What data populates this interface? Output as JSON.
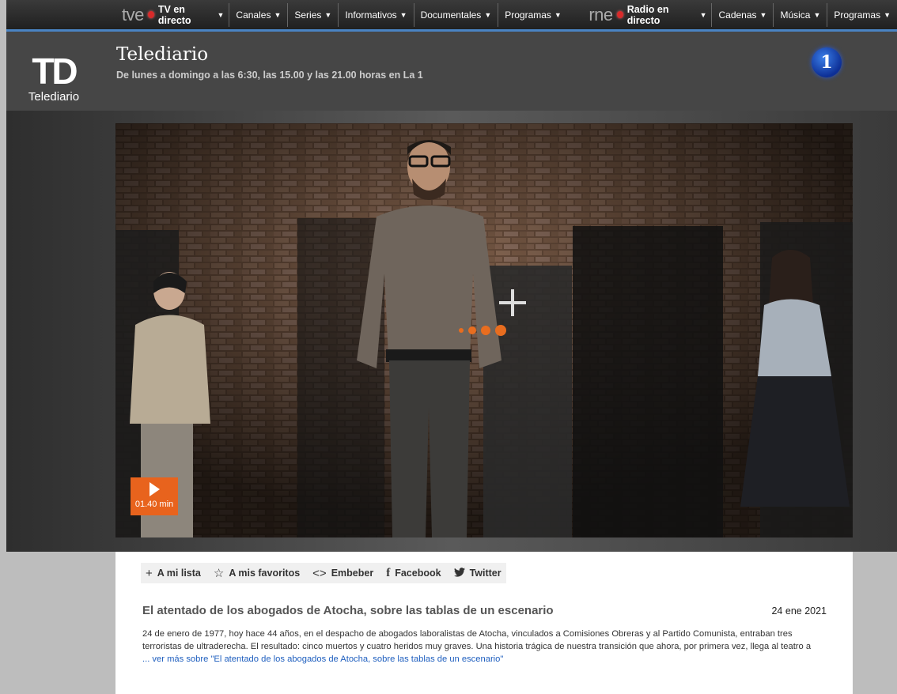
{
  "nav": {
    "tve_logo": "tve",
    "tv_live": "TV en directo",
    "tv_items": [
      "Canales",
      "Series",
      "Informativos",
      "Documentales",
      "Programas"
    ],
    "rne_logo": "rne",
    "radio_live": "Radio en directo",
    "radio_items": [
      "Cadenas",
      "Música",
      "Programas"
    ]
  },
  "header": {
    "logo_mark": "TD",
    "logo_text": "Telediario",
    "title": "Telediario",
    "subtitle": "De lunes a domingo a las 6:30, las 15.00 y las 21.00 horas en La 1",
    "channel_badge": "1"
  },
  "player": {
    "duration": "01.40 min",
    "play_icon": "play-icon",
    "accent": "#e8631d"
  },
  "actions": [
    {
      "icon": "+",
      "label": "A mi lista"
    },
    {
      "icon": "☆",
      "label": "A mis favoritos"
    },
    {
      "icon": "<>",
      "label": "Embeber"
    },
    {
      "icon": "f",
      "label": "Facebook"
    },
    {
      "icon": "🐦",
      "label": "Twitter"
    }
  ],
  "article": {
    "title": "El atentado de los abogados de Atocha, sobre las tablas de un escenario",
    "date": "24 ene 2021",
    "body": "24 de enero de 1977, hoy hace 44 años, en el despacho de abogados laboralistas de Atocha, vinculados a Comisiones Obreras y al Partido Comunista, entraban tres terroristas de ultraderecha. El resultado: cinco muertos y cuatro heridos muy graves. Una historia trágica de nuestra transición que ahora, por primera vez, llega al teatro a",
    "read_more": "... ver más sobre \"El atentado de los abogados de Atocha, sobre las tablas de un escenario\""
  }
}
